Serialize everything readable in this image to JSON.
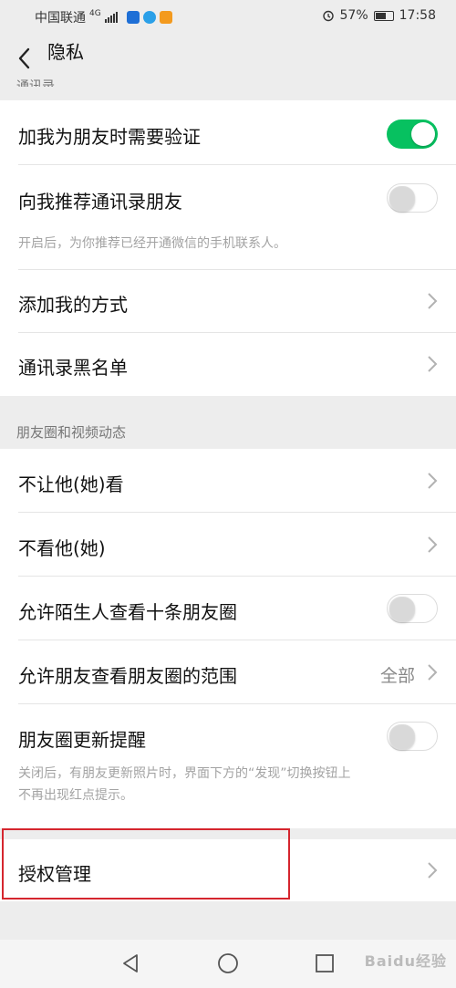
{
  "status_bar": {
    "carrier": "中国联通",
    "network": "4G",
    "battery": "57%",
    "time": "17:58"
  },
  "header": {
    "title": "隐私"
  },
  "sections": {
    "contacts_header_partial": "通讯录",
    "moments_header": "朋友圈和视频动态"
  },
  "rows": {
    "verify_friend": {
      "label": "加我为朋友时需要验证",
      "state": "on"
    },
    "recommend_contacts": {
      "label": "向我推荐通讯录朋友",
      "desc": "开启后，为你推荐已经开通微信的手机联系人。",
      "state": "off"
    },
    "add_me_methods": {
      "label": "添加我的方式"
    },
    "contact_blacklist": {
      "label": "通讯录黑名单"
    },
    "dont_let_see": {
      "label": "不让他(她)看"
    },
    "dont_see": {
      "label": "不看他(她)"
    },
    "stranger_ten_posts": {
      "label": "允许陌生人查看十条朋友圈",
      "state": "off"
    },
    "moments_range": {
      "label": "允许朋友查看朋友圈的范围",
      "value": "全部"
    },
    "moments_update_reminder": {
      "label": "朋友圈更新提醒",
      "desc_line1": "关闭后，有朋友更新照片时，界面下方的“发现”切换按钮上",
      "desc_line2": "不再出现红点提示。",
      "state": "off"
    },
    "authorization_management": {
      "label": "授权管理"
    }
  },
  "colors": {
    "toggle_on": "#07c160",
    "highlight": "#d5262e"
  },
  "watermark": "Baidu经验"
}
